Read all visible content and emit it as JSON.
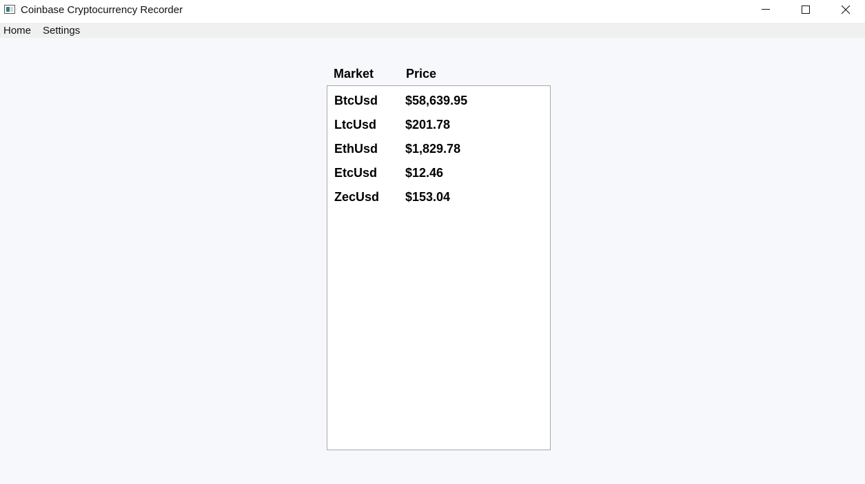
{
  "window": {
    "title": "Coinbase Cryptocurrency Recorder",
    "icons": {
      "app": "app-icon",
      "minimize": "minimize-icon",
      "maximize": "maximize-icon",
      "close": "close-icon"
    }
  },
  "menu": {
    "items": [
      {
        "label": "Home"
      },
      {
        "label": "Settings"
      }
    ]
  },
  "table": {
    "headers": {
      "market": "Market",
      "price": "Price"
    },
    "rows": [
      {
        "market": "BtcUsd",
        "price": "$58,639.95"
      },
      {
        "market": "LtcUsd",
        "price": "$201.78"
      },
      {
        "market": "EthUsd",
        "price": "$1,829.78"
      },
      {
        "market": "EtcUsd",
        "price": "$12.46"
      },
      {
        "market": "ZecUsd",
        "price": "$153.04"
      }
    ]
  },
  "colors": {
    "background": "#f7f8fc",
    "menubar": "#f0f0f0",
    "list_border": "#a8a8a8",
    "text": "#000000"
  }
}
